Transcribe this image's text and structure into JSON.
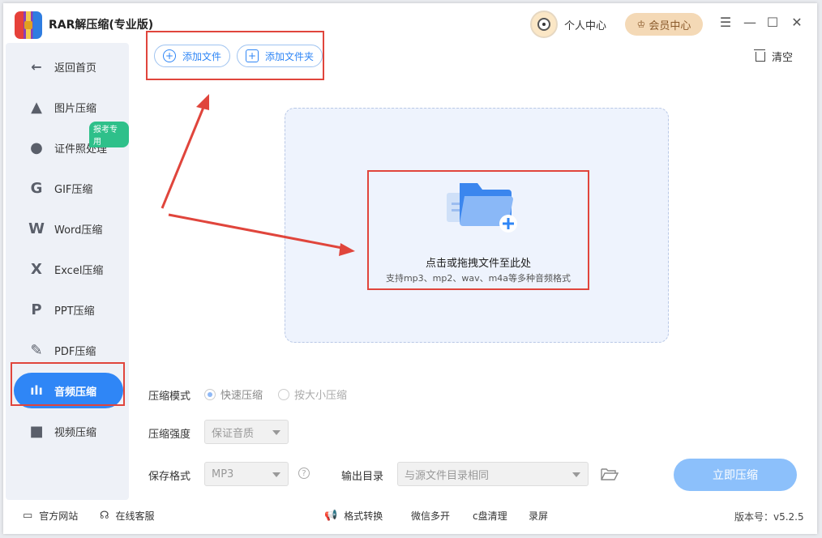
{
  "app": {
    "title": "RAR解压缩(专业版)"
  },
  "header": {
    "profile_label": "个人中心",
    "vip_label": "会员中心",
    "window_controls": [
      "menu",
      "minimize",
      "maximize",
      "close"
    ]
  },
  "sidebar": {
    "back_label": "返回首页",
    "badge": "报考专用",
    "items": [
      {
        "label": "图片压缩",
        "icon": "image-icon"
      },
      {
        "label": "证件照处理",
        "icon": "id-photo-icon"
      },
      {
        "label": "GIF压缩",
        "icon": "gif-icon"
      },
      {
        "label": "Word压缩",
        "icon": "word-icon"
      },
      {
        "label": "Excel压缩",
        "icon": "excel-icon"
      },
      {
        "label": "PPT压缩",
        "icon": "ppt-icon"
      },
      {
        "label": "PDF压缩",
        "icon": "pdf-icon"
      },
      {
        "label": "音频压缩",
        "icon": "audio-icon",
        "active": true
      },
      {
        "label": "视频压缩",
        "icon": "video-icon"
      }
    ]
  },
  "toolbar": {
    "add_file": "添加文件",
    "add_folder": "添加文件夹",
    "clear": "清空"
  },
  "dropzone": {
    "title": "点击或拖拽文件至此处",
    "subtitle": "支持mp3、mp2、wav、m4a等多种音频格式"
  },
  "settings": {
    "mode_label": "压缩模式",
    "mode_options": [
      "快速压缩",
      "按大小压缩"
    ],
    "mode_selected": "快速压缩",
    "strength_label": "压缩强度",
    "strength_value": "保证音质",
    "format_label": "保存格式",
    "format_value": "MP3",
    "output_label": "输出目录",
    "output_value": "与源文件目录相同",
    "start_button": "立即压缩"
  },
  "footer": {
    "website": "官方网站",
    "support": "在线客服",
    "format_convert": "格式转换",
    "wechat_multi": "微信多开",
    "c_clean": "c盘清理",
    "record": "录屏",
    "version": "版本号：v5.2.5"
  },
  "colors": {
    "accent": "#2f86f6",
    "highlight_box": "#e0453c",
    "start_button": "#8cc0fb"
  }
}
